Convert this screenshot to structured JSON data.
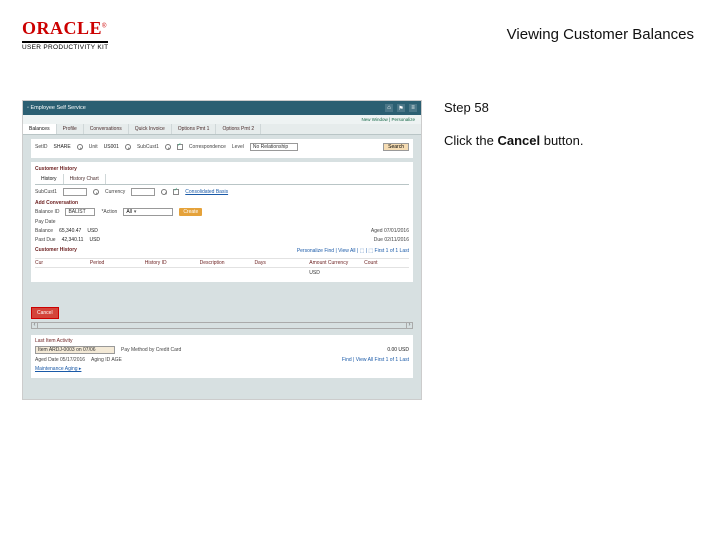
{
  "header": {
    "brand": "ORACLE",
    "brand_sub": "USER PRODUCTIVITY KIT",
    "title": "Viewing Customer Balances"
  },
  "instructions": {
    "step_label": "Step 58",
    "action_prefix": "Click the ",
    "action_bold": "Cancel",
    "action_suffix": " button."
  },
  "shot": {
    "bar_title": "◦ Employee Self Service",
    "icons": {
      "home": "⌂",
      "flag": "⚑",
      "menu": "≡"
    },
    "crumb": "New Window | Personalize",
    "tabs": [
      "Balances",
      "Profile",
      "Conversations",
      "Quick Invoice",
      "Options Pmt 1",
      "Options Pmt 2"
    ],
    "line1": {
      "setid_lbl": "SetID",
      "setid_val": "SHARE",
      "unit_lbl": "Unit",
      "unit_val": "US001",
      "subc_lbl": "SubCust1",
      "corr_lbl": "Correspondence",
      "level_lbl": "Level",
      "level_val": "No Relationship",
      "search_btn": "Search"
    },
    "sect1_title": "Customer History",
    "subtabs": [
      "History",
      "History Chart"
    ],
    "line2": {
      "subc1_lbl": "SubCust1",
      "subc1_ph": "",
      "curr_lbl": "Currency",
      "curr_ph": "",
      "cons_lbl": "Consolidated Basis"
    },
    "sect2_title": "Add Conversation",
    "line3": {
      "event_lbl": "Balance ID",
      "event_val": "BALIST",
      "calc_lbl": "*Action",
      "calc_val": "All",
      "go_btn": "Create"
    },
    "pay_row": {
      "lbl": "Pay Date"
    },
    "bal_a": {
      "lbl": "Balance",
      "amt": "65,340.47",
      "cur": "USD",
      "aged": "Aged 07/01/2016"
    },
    "bal_b": {
      "lbl": "Past Due",
      "amt": "42,340.11",
      "cur": "USD",
      "due": "Due 02/11/2016"
    },
    "hist": {
      "title": "Customer History",
      "right": "Personalize   Find | View All | ⬚ | ⬚    First  1 of 1  Last",
      "cols": [
        "Cur",
        "Period",
        "History ID",
        "Description",
        "Days",
        "Amount Currency",
        "Count"
      ],
      "row": [
        "",
        "",
        "",
        "",
        "",
        "USD",
        ""
      ]
    },
    "cancel_btn": "Cancel",
    "lower": {
      "title": "Last Item Activity",
      "line": {
        "l1": "Item  ARDJ-0003  on 07/06",
        "l2": "Pay Method  by Credit Card",
        "amt": "0.00   USD"
      },
      "aged": {
        "lbl": "Aged Date  05/17/2016",
        "id": "Aging ID  AGE"
      },
      "right": "Find | View All    First  1 of 1  Last"
    },
    "footer_link": "Maintenance Aging ▸"
  }
}
